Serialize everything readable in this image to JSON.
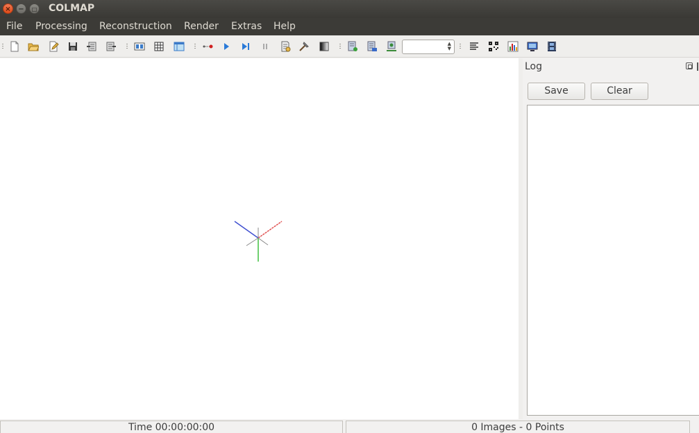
{
  "window": {
    "title": "COLMAP",
    "close_glyph": "×",
    "min_glyph": "−",
    "max_glyph": "□"
  },
  "menu": [
    "File",
    "Processing",
    "Reconstruction",
    "Render",
    "Extras",
    "Help"
  ],
  "toolbar": {
    "icons": [
      "new-project-icon",
      "open-project-icon",
      "edit-project-icon",
      "save-project-icon",
      "import-model-icon",
      "export-model-icon",
      "feature-extraction-icon",
      "feature-matching-icon",
      "database-management-icon",
      "automatic-reconstruction-icon",
      "start-reconstruction-icon",
      "step-reconstruction-icon",
      "pause-reconstruction-icon",
      "reconstruction-options-icon",
      "bundle-adjustment-icon",
      "render-options-icon",
      "dense-reconstruction-icon",
      "reset-view-icon",
      "grab-image-icon",
      "log-icon",
      "match-matrix-icon",
      "statistics-icon",
      "grab-movie-icon",
      "film-icon"
    ],
    "zoom_value": ""
  },
  "axes": {
    "x_color": "#e05050",
    "y_color": "#40c040",
    "z_color": "#4050d0"
  },
  "log": {
    "title": "Log",
    "save_label": "Save",
    "clear_label": "Clear",
    "text": ""
  },
  "status": {
    "time": "Time 00:00:00:00",
    "counts": "0 Images - 0 Points"
  }
}
